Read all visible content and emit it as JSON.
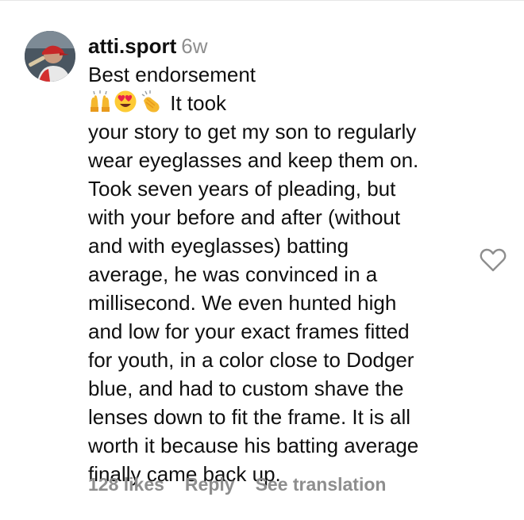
{
  "comment": {
    "username": "atti.sport",
    "timestamp": "6w",
    "text_first": "Best endorsement",
    "emojis": [
      "raising-hands-emoji",
      "heart-eyes-emoji",
      "clapping-hands-emoji"
    ],
    "text_after_emojis": " It took",
    "text_rest": "your story to get my son to regularly\nwear eyeglasses and keep them on.\nTook seven years of pleading, but\nwith your before and after (without\nand with eyeglasses) batting\naverage, he was convinced in a\nmillisecond. We even hunted high\nand low for your exact frames fitted\nfor youth, in a color close to Dodger\nblue, and had to custom shave the\nlenses down to fit the frame. It is all\nworth it because his batting average\nfinally came back up.",
    "likes_label": "128 likes",
    "reply_label": "Reply",
    "translate_label": "See translation",
    "like_icon": "heart-outline-icon"
  },
  "colors": {
    "text": "#0f0f0f",
    "muted": "#8e8e8e",
    "background": "#ffffff"
  }
}
